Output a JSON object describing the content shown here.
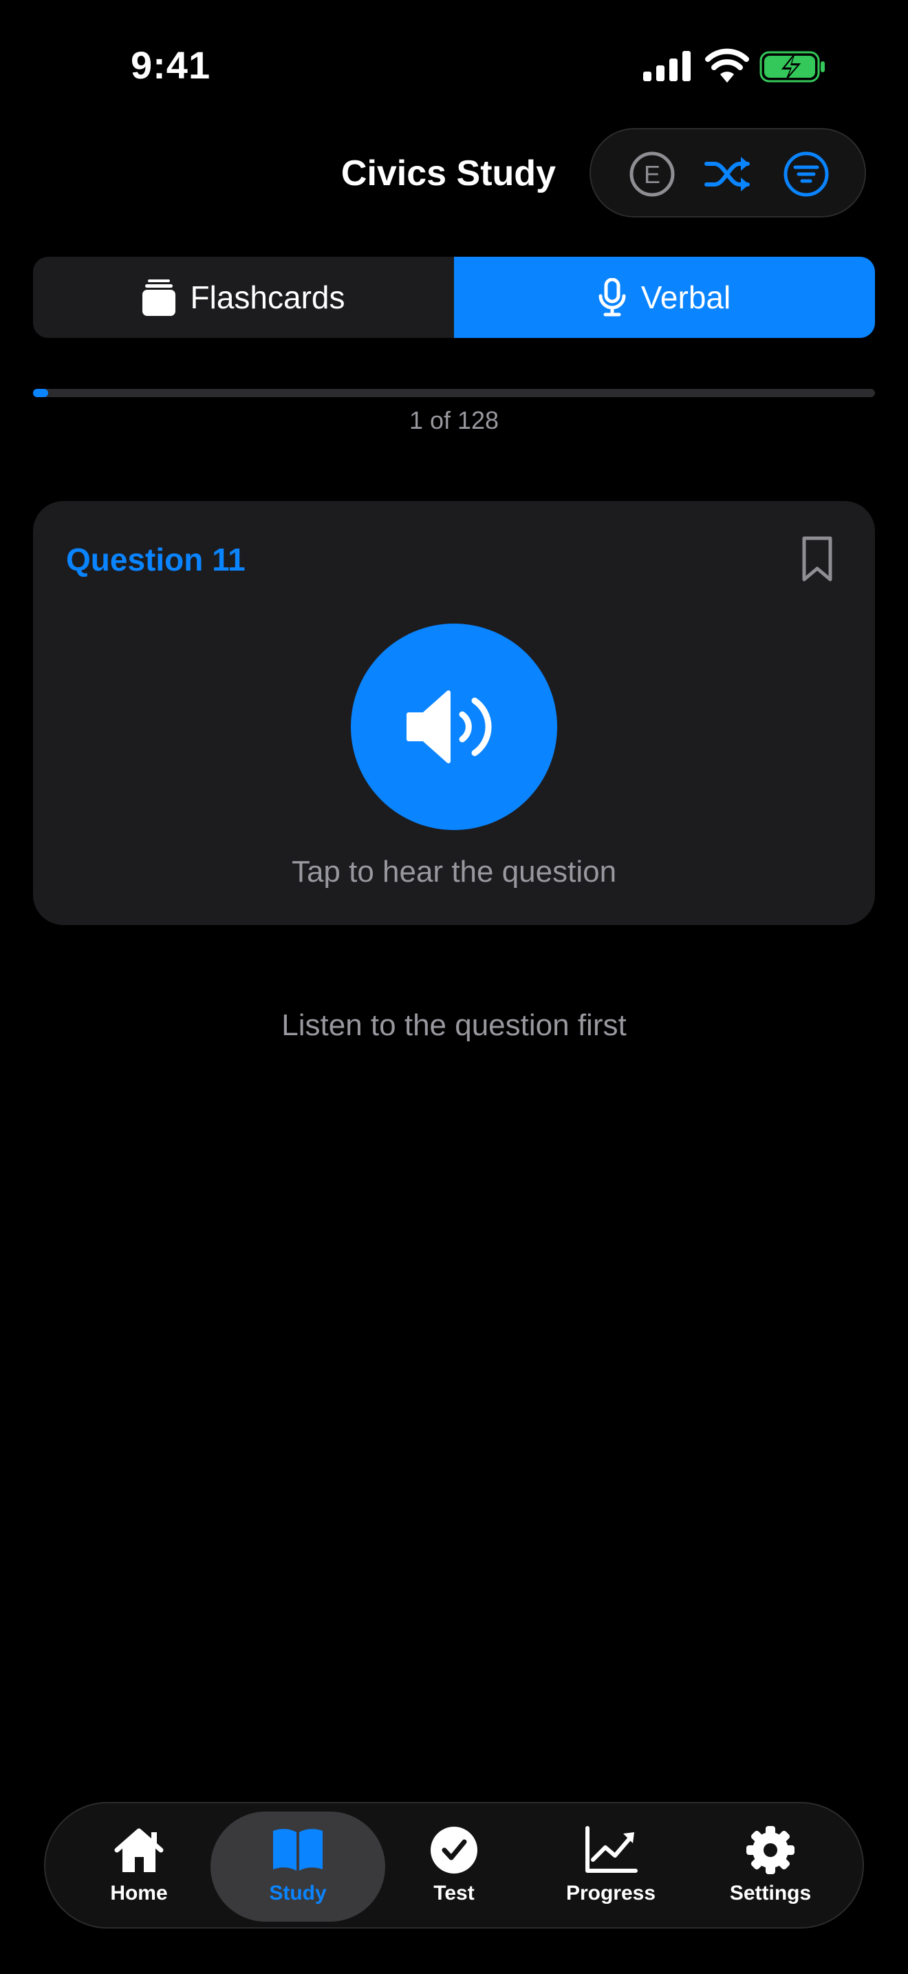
{
  "status_bar": {
    "time": "9:41",
    "icons": [
      "cellular-signal-icon",
      "wifi-icon",
      "battery-charging-icon"
    ]
  },
  "header": {
    "title": "Civics Study",
    "buttons": [
      {
        "name": "english-language-button",
        "icon": "letter-e-circle-icon",
        "glyph": "E"
      },
      {
        "name": "shuffle-button",
        "icon": "shuffle-icon"
      },
      {
        "name": "filter-button",
        "icon": "filter-lines-circle-icon"
      }
    ]
  },
  "segments": {
    "flashcards": {
      "label": "Flashcards",
      "icon": "cards-stack-icon",
      "selected": false
    },
    "verbal": {
      "label": "Verbal",
      "icon": "microphone-icon",
      "selected": true
    }
  },
  "progress": {
    "label": "1 of 128",
    "current": 1,
    "total": 128
  },
  "card": {
    "question_label": "Question 11",
    "bookmark_icon": "bookmark-outline-icon",
    "speaker_icon": "speaker-wave-icon",
    "tap_hint": "Tap to hear the question"
  },
  "listen_hint": "Listen to the question first",
  "tabbar": {
    "tabs": [
      {
        "label": "Home",
        "icon": "house-icon",
        "selected": false
      },
      {
        "label": "Study",
        "icon": "open-book-icon",
        "selected": true
      },
      {
        "label": "Test",
        "icon": "checkmark-circle-icon",
        "selected": false
      },
      {
        "label": "Progress",
        "icon": "chart-line-up-icon",
        "selected": false
      },
      {
        "label": "Settings",
        "icon": "gear-icon",
        "selected": false
      }
    ]
  },
  "colors": {
    "accent": "#0a84ff",
    "background": "#000000",
    "card": "#1c1c1e",
    "secondary_text": "#98989f",
    "battery_green": "#34c759"
  }
}
